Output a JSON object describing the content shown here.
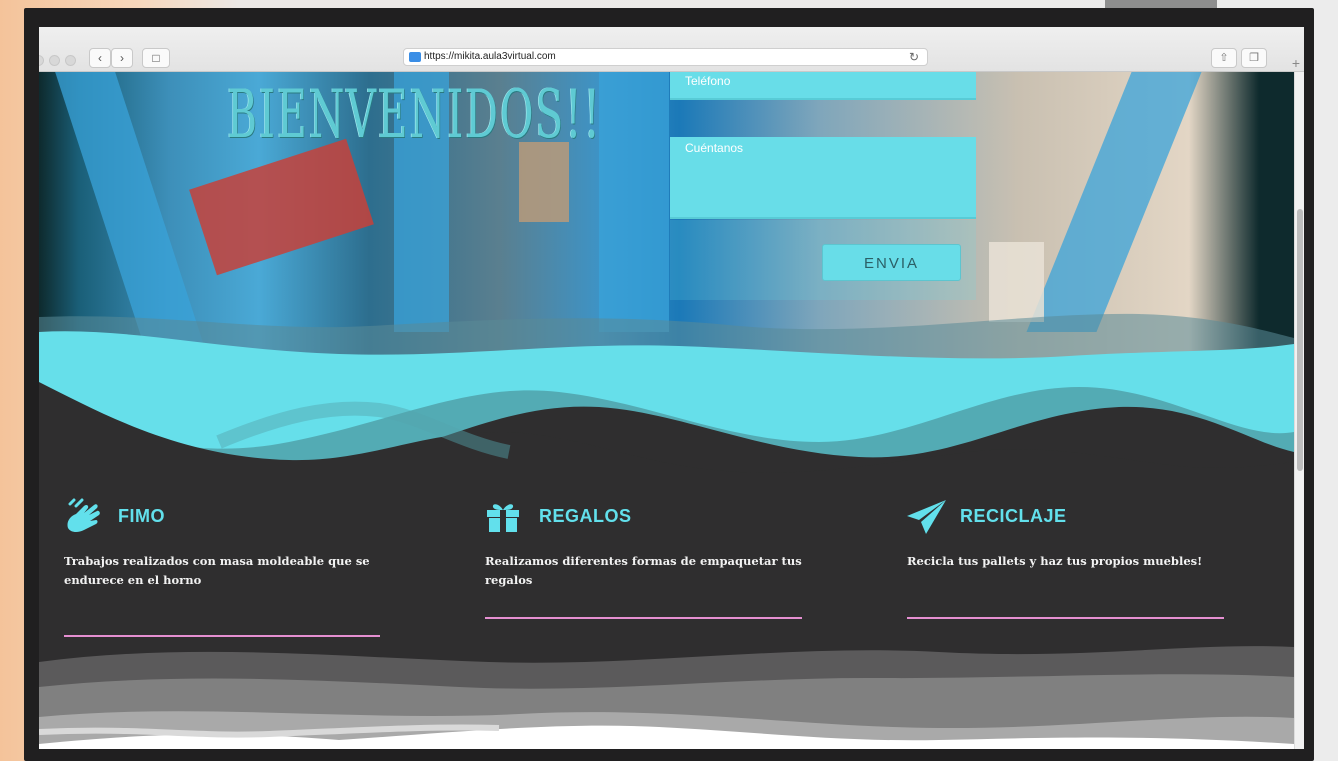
{
  "browser": {
    "url": "https://mikita.aula3virtual.com"
  },
  "hero": {
    "welcome": "BIENVENIDOS!!",
    "phone_placeholder": "Teléfono",
    "message_placeholder": "Cuéntanos",
    "send_label": "ENVIA"
  },
  "features": [
    {
      "title": "FIMO",
      "description": "Trabajos realizados con masa moldeable que se endurece en el horno",
      "icon": "hands-icon"
    },
    {
      "title": "REGALOS",
      "description": "Realizamos diferentes formas de empaquetar tus regalos",
      "icon": "gift-icon"
    },
    {
      "title": "RECICLAJE",
      "description": "Recicla tus pallets y haz tus propios muebles!",
      "icon": "paper-plane-icon"
    }
  ],
  "colors": {
    "accent_cyan": "#62e0ec",
    "divider_pink": "#e58fd1",
    "dark_bg": "#2f2e2f"
  }
}
